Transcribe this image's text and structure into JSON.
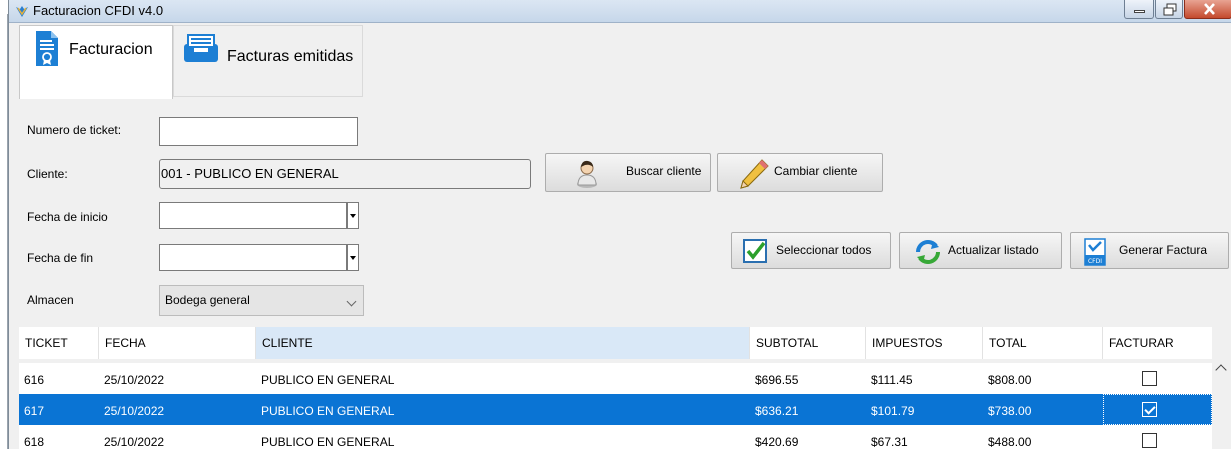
{
  "window": {
    "title": "Facturacion CFDI v4.0",
    "accent": "#0a74d4"
  },
  "tabs": [
    {
      "label": "Facturacion",
      "icon": "document-certificate-icon",
      "active": true
    },
    {
      "label": "Facturas emitidas",
      "icon": "inbox-tray-icon",
      "active": false
    }
  ],
  "form": {
    "ticket_label": "Numero de ticket:",
    "ticket_value": "",
    "cliente_label": "Cliente:",
    "cliente_value": "001 - PUBLICO EN GENERAL",
    "fecha_inicio_label": "Fecha de inicio",
    "fecha_inicio_value": "",
    "fecha_fin_label": "Fecha de fin",
    "fecha_fin_value": "",
    "almacen_label": "Almacen",
    "almacen_value": "Bodega general"
  },
  "buttons": {
    "buscar_cliente": "Buscar cliente",
    "cambiar_cliente": "Cambiar cliente",
    "seleccionar_todos": "Seleccionar todos",
    "actualizar_listado": "Actualizar listado",
    "generar_factura": "Generar Factura"
  },
  "table": {
    "columns": [
      "TICKET",
      "FECHA",
      "CLIENTE",
      "SUBTOTAL",
      "IMPUESTOS",
      "TOTAL",
      "FACTURAR"
    ],
    "rows": [
      {
        "ticket": "616",
        "fecha": "25/10/2022",
        "cliente": "PUBLICO EN GENERAL",
        "subtotal": "$696.55",
        "impuestos": "$111.45",
        "total": "$808.00",
        "facturar": false,
        "selected": false
      },
      {
        "ticket": "617",
        "fecha": "25/10/2022",
        "cliente": "PUBLICO EN GENERAL",
        "subtotal": "$636.21",
        "impuestos": "$101.79",
        "total": "$738.00",
        "facturar": true,
        "selected": true
      },
      {
        "ticket": "618",
        "fecha": "25/10/2022",
        "cliente": "PUBLICO EN GENERAL",
        "subtotal": "$420.69",
        "impuestos": "$67.31",
        "total": "$488.00",
        "facturar": false,
        "selected": false
      }
    ]
  }
}
